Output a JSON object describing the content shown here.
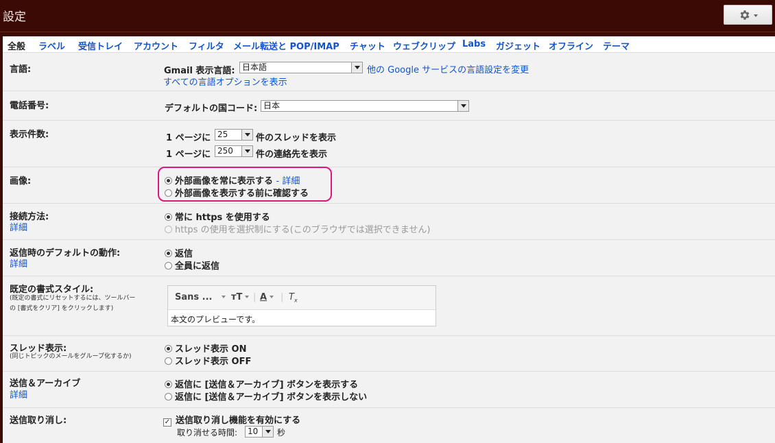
{
  "header": {
    "title": "設定",
    "settings_icon": "gear-icon"
  },
  "tabs": [
    {
      "label": "全般",
      "active": true
    },
    {
      "label": "ラベル"
    },
    {
      "label": "受信トレイ"
    },
    {
      "label": "アカウント"
    },
    {
      "label": "フィルタ"
    },
    {
      "label": "メール転送と POP/IMAP"
    },
    {
      "label": "チャット"
    },
    {
      "label": "ウェブクリップ"
    },
    {
      "label": "Labs"
    },
    {
      "label": "ガジェット"
    },
    {
      "label": "オフライン"
    },
    {
      "label": "テーマ"
    }
  ],
  "language": {
    "label": "言語:",
    "display_label": "Gmail 表示言語:",
    "selected": "日本語",
    "other_link": "他の Google サービスの言語設定を変更",
    "all_options_link": "すべての言語オプションを表示"
  },
  "phone": {
    "label": "電話番号:",
    "country_label": "デフォルトの国コード:",
    "selected": "日本"
  },
  "page_size": {
    "label": "表示件数:",
    "threads_prefix": "1 ページに",
    "threads_value": "25",
    "threads_suffix": "件のスレッドを表示",
    "contacts_prefix": "1 ページに",
    "contacts_value": "250",
    "contacts_suffix": "件の連絡先を表示"
  },
  "images": {
    "label": "画像:",
    "option_always": "外部画像を常に表示する",
    "details_link": "- 詳細",
    "option_ask": "外部画像を表示する前に確認する",
    "selected": "always"
  },
  "connection": {
    "label": "接続方法:",
    "details_link": "詳細",
    "option_always": "常に https を使用する",
    "option_optional": "https の使用を選択制にする(このブラウザでは選択できません)"
  },
  "reply": {
    "label": "返信時のデフォルトの動作:",
    "details_link": "詳細",
    "option_reply": "返信",
    "option_reply_all": "全員に返信"
  },
  "text_style": {
    "label": "既定の書式スタイル:",
    "note_line1": "(既定の書式にリセットするには、ツールバー",
    "note_line2": "の [書式をクリア] をクリックします)",
    "font_name": "Sans ...",
    "preview_text": "本文のプレビューです。"
  },
  "conversation": {
    "label": "スレッド表示:",
    "note": "(同じトピックのメールをグループ化するか)",
    "option_on": "スレッド表示 ON",
    "option_off": "スレッド表示 OFF"
  },
  "send_archive": {
    "label": "送信＆アーカイブ",
    "details_link": "詳細",
    "option_show": "返信に [送信＆アーカイブ] ボタンを表示する",
    "option_hide": "返信に [送信＆アーカイブ] ボタンを表示しない"
  },
  "undo_send": {
    "label": "送信取り消し:",
    "checkbox_label": "送信取り消し機能を有効にする",
    "period_label": "取り消せる時間:",
    "period_value": "10",
    "period_unit": "秒",
    "checked": true
  },
  "colors": {
    "header_bg": "#3b0a04",
    "link": "#1155cc",
    "highlight": "#e0157a",
    "panel_bg": "#f2f2f2"
  }
}
